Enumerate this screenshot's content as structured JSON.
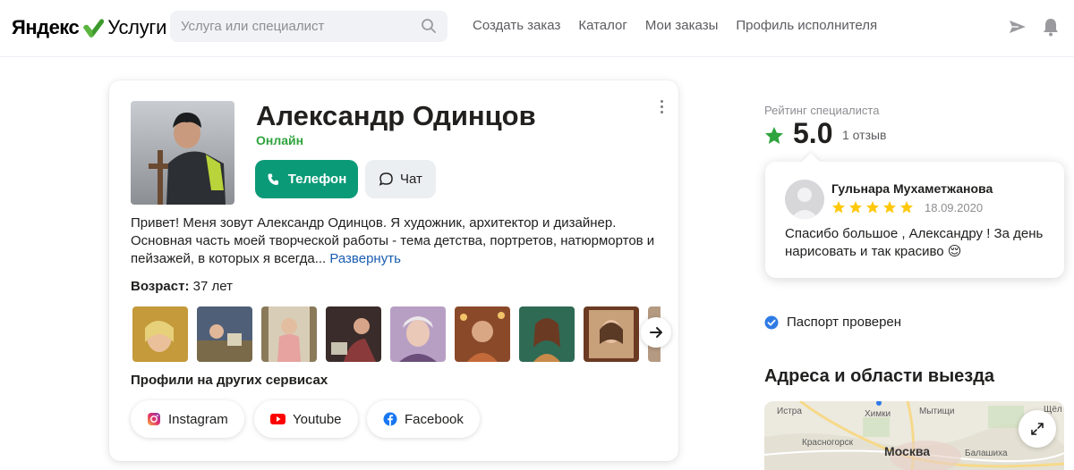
{
  "header": {
    "logo_left": "Яндекс",
    "logo_right": "Услуги",
    "search_placeholder": "Услуга или специалист",
    "nav": [
      {
        "label": "Создать заказ"
      },
      {
        "label": "Каталог"
      },
      {
        "label": "Мои заказы"
      },
      {
        "label": "Профиль исполнителя"
      }
    ],
    "icons": [
      "send-icon",
      "bell-icon"
    ]
  },
  "profile": {
    "name": "Александр Одинцов",
    "status": "Онлайн",
    "phone_button": "Телефон",
    "chat_button": "Чат",
    "about": "Привет! Меня зовут Александр Одинцов. Я художник, архитектор и дизайнер. Основная часть моей творческой работы - тема детства, портретов, натюрмортов и пейзажей, в которых я всегда...",
    "expand_link": "Развернуть",
    "age_label": "Возраст:",
    "age_value": "37 лет",
    "gallery_count": 9,
    "profiles_title": "Профили на других сервисах",
    "socials": [
      {
        "label": "Instagram",
        "icon": "instagram-icon"
      },
      {
        "label": "Youtube",
        "icon": "youtube-icon"
      },
      {
        "label": "Facebook",
        "icon": "facebook-icon"
      }
    ]
  },
  "rating": {
    "label": "Рейтинг специалиста",
    "value": "5.0",
    "reviews": "1 отзыв"
  },
  "review": {
    "author": "Гульнара Мухаметжанова",
    "stars": 5,
    "date": "18.09.2020",
    "text": "Спасибо большое , Александру ! За день нарисовать и так красиво 😌"
  },
  "passport": "Паспорт проверен",
  "addresses": {
    "title": "Адреса и области выезда",
    "map_labels": [
      "Истра",
      "Химки",
      "Мытищи",
      "Красногорск",
      "Москва",
      "Балашиха",
      "Щёл"
    ]
  },
  "colors": {
    "accent_green": "#0b9a78",
    "online": "#2fa33d",
    "link": "#1a5cb0",
    "star": "#ffc80a",
    "rating_star": "#2fa33d"
  }
}
